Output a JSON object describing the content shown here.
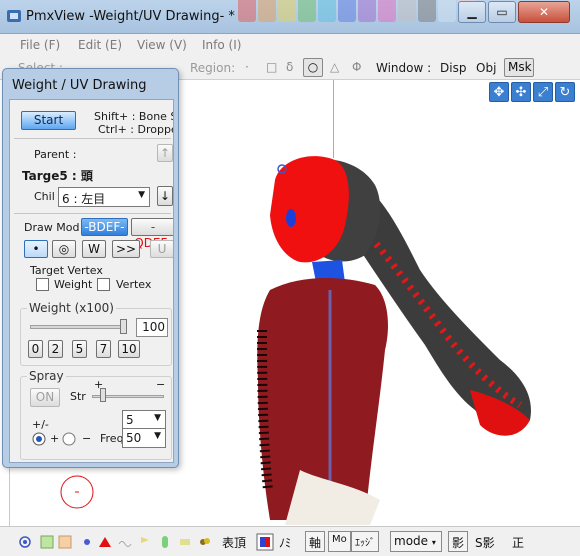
{
  "window": {
    "title": "PmxView -Weight/UV Drawing- *",
    "minimize": "▁",
    "maximize": "▭",
    "close": "✕"
  },
  "palette": [
    "#e06060",
    "#e0a060",
    "#e0d060",
    "#70c070",
    "#60c0e0",
    "#6080e0",
    "#a070d0",
    "#e070c0",
    "#c0c0c0",
    "#808080",
    "#d0e0f0",
    "#f0d0d0"
  ],
  "menu": {
    "file": "File (F)",
    "edit": "Edit (E)",
    "view": "View (V)",
    "info": "Info (I)"
  },
  "toolbar": {
    "select_label": "Select :",
    "region_label": "Region:",
    "region_items": [
      "·",
      "□",
      "δ",
      "○",
      "△",
      "Φ"
    ],
    "window_label": "Window :",
    "disp": "Disp",
    "obj": "Obj",
    "msk": "Msk"
  },
  "dialog": {
    "title": "Weight / UV Drawing",
    "start": "Start",
    "hint_shift": "Shift+ : Bone Se",
    "hint_ctrl": "Ctrl+ : Dropper",
    "parent_label": "Parent :",
    "target_label": "Targe5 : 頭",
    "child_label": "Chil",
    "child_value": "6 : 左目",
    "draw_mode_label": "Draw Mod",
    "bdef": "-BDEF-",
    "qdef": "-QDEF-",
    "brush_buttons": [
      "•",
      "◎",
      "W",
      ">>",
      "U"
    ],
    "target_vertex_label": "Target Vertex",
    "weight_check": "Weight",
    "vertex_check": "Vertex",
    "weight_label": "Weight (x100)",
    "weight_value": "100",
    "weight_level": 1.0,
    "preset_buttons": [
      "0",
      "2",
      "5",
      "7",
      "10"
    ],
    "spray_label": "Spray",
    "spray_on": "ON",
    "str_label": "Str",
    "str_plus": "+",
    "str_minus": "−",
    "spray_size": "5",
    "plusminus_label": "+/-",
    "plus": "+",
    "minus": "−",
    "freq_label": "Freq",
    "freq_value": "50"
  },
  "statusbar": {
    "hyouchou": "表頂",
    "mi": "ﾉﾐ",
    "jiku": "軸",
    "mo": "Mo",
    "ejji": "ｴｯｼﾞ",
    "mode": "mode",
    "kage": "影",
    "s_kage": "S影",
    "sei": "正"
  }
}
